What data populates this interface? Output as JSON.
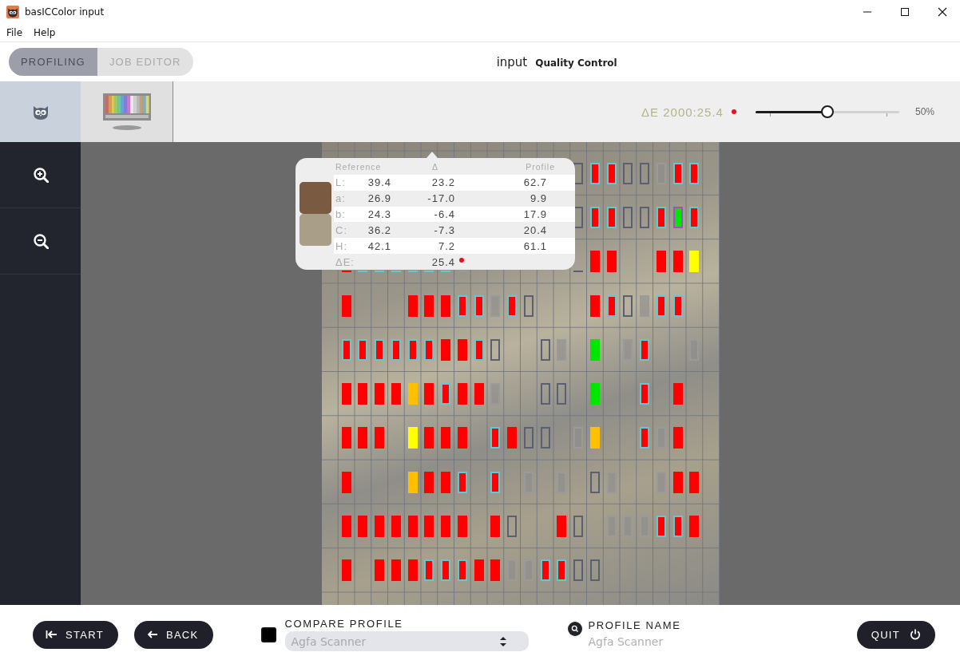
{
  "window": {
    "title": "basICColor input"
  },
  "menu": [
    "File",
    "Help"
  ],
  "mode_tabs": [
    {
      "label": "PROFILING",
      "selected": true
    },
    {
      "label": "JOB EDITOR",
      "selected": false
    }
  ],
  "header": {
    "app": "input",
    "view": "Quality Control"
  },
  "thumbnails": [
    {
      "kind": "owl",
      "selected": true
    },
    {
      "kind": "chart",
      "selected": false
    }
  ],
  "delta_e": {
    "label": "ΔE 2000:25.4",
    "tolerance_exceeded": true
  },
  "overlay_slider": {
    "level": 0.5,
    "reading": "50%"
  },
  "sidebar": {
    "tools": [
      {
        "kind": "zoom-in"
      },
      {
        "kind": "zoom-out"
      }
    ]
  },
  "patch_grid": {
    "rows": [
      {
        "patches": [
          {
            "kind": "none"
          },
          {
            "kind": "none"
          },
          {
            "kind": "none"
          },
          {
            "kind": "none"
          },
          {
            "kind": "none"
          },
          {
            "kind": "none"
          },
          {
            "kind": "none"
          },
          {
            "kind": "none"
          },
          {
            "kind": "none"
          },
          {
            "kind": "none"
          },
          {
            "kind": "none"
          },
          {
            "kind": "none"
          },
          {
            "kind": "none"
          },
          {
            "kind": "none"
          },
          {
            "kind": "hollow"
          },
          {
            "kind": "red-ring"
          },
          {
            "kind": "red-ring"
          },
          {
            "kind": "hollow"
          },
          {
            "kind": "hollow"
          },
          {
            "kind": "grey"
          },
          {
            "kind": "red-ring"
          },
          {
            "kind": "red-ring"
          }
        ]
      },
      {
        "patches": [
          {
            "kind": "none"
          },
          {
            "kind": "none"
          },
          {
            "kind": "none"
          },
          {
            "kind": "none"
          },
          {
            "kind": "none"
          },
          {
            "kind": "none"
          },
          {
            "kind": "none"
          },
          {
            "kind": "none"
          },
          {
            "kind": "none"
          },
          {
            "kind": "none"
          },
          {
            "kind": "none"
          },
          {
            "kind": "none"
          },
          {
            "kind": "none"
          },
          {
            "kind": "none"
          },
          {
            "kind": "hollow"
          },
          {
            "kind": "red-ring"
          },
          {
            "kind": "red-ring"
          },
          {
            "kind": "hollow"
          },
          {
            "kind": "hollow"
          },
          {
            "kind": "red-ring"
          },
          {
            "kind": "green-ring"
          },
          {
            "kind": "red-ring"
          }
        ]
      },
      {
        "patches": [
          {
            "kind": "red"
          },
          {
            "kind": "red-ring"
          },
          {
            "kind": "red-ring"
          },
          {
            "kind": "red-ring"
          },
          {
            "kind": "red-ring"
          },
          {
            "kind": "red-ring"
          },
          {
            "kind": "red-ring"
          },
          {
            "kind": "grey"
          },
          {
            "kind": "none"
          },
          {
            "kind": "none"
          },
          {
            "kind": "none"
          },
          {
            "kind": "none"
          },
          {
            "kind": "none"
          },
          {
            "kind": "none"
          },
          {
            "kind": "hollow"
          },
          {
            "kind": "red"
          },
          {
            "kind": "red"
          },
          {
            "kind": "none"
          },
          {
            "kind": "none"
          },
          {
            "kind": "red"
          },
          {
            "kind": "red"
          },
          {
            "kind": "yellow"
          }
        ]
      },
      {
        "patches": [
          {
            "kind": "red"
          },
          {
            "kind": "none"
          },
          {
            "kind": "none"
          },
          {
            "kind": "none"
          },
          {
            "kind": "red"
          },
          {
            "kind": "red"
          },
          {
            "kind": "red"
          },
          {
            "kind": "red-ring"
          },
          {
            "kind": "red-ring"
          },
          {
            "kind": "grey"
          },
          {
            "kind": "red-ring"
          },
          {
            "kind": "hollow"
          },
          {
            "kind": "none"
          },
          {
            "kind": "none"
          },
          {
            "kind": "none"
          },
          {
            "kind": "red"
          },
          {
            "kind": "red-ring"
          },
          {
            "kind": "hollow"
          },
          {
            "kind": "grey"
          },
          {
            "kind": "red-ring"
          },
          {
            "kind": "red-ring"
          },
          {
            "kind": "none"
          }
        ]
      },
      {
        "patches": [
          {
            "kind": "red-ring"
          },
          {
            "kind": "red-ring"
          },
          {
            "kind": "red-ring"
          },
          {
            "kind": "red-ring"
          },
          {
            "kind": "red-ring"
          },
          {
            "kind": "red-ring"
          },
          {
            "kind": "red"
          },
          {
            "kind": "red"
          },
          {
            "kind": "red-ring"
          },
          {
            "kind": "hollow"
          },
          {
            "kind": "none"
          },
          {
            "kind": "none"
          },
          {
            "kind": "hollow"
          },
          {
            "kind": "grey"
          },
          {
            "kind": "none"
          },
          {
            "kind": "green"
          },
          {
            "kind": "none"
          },
          {
            "kind": "grey"
          },
          {
            "kind": "red-ring"
          },
          {
            "kind": "none"
          },
          {
            "kind": "none"
          },
          {
            "kind": "grey"
          }
        ]
      },
      {
        "patches": [
          {
            "kind": "red"
          },
          {
            "kind": "red"
          },
          {
            "kind": "red"
          },
          {
            "kind": "red"
          },
          {
            "kind": "orange"
          },
          {
            "kind": "red"
          },
          {
            "kind": "red-ring"
          },
          {
            "kind": "red"
          },
          {
            "kind": "red"
          },
          {
            "kind": "grey"
          },
          {
            "kind": "none"
          },
          {
            "kind": "none"
          },
          {
            "kind": "hollow"
          },
          {
            "kind": "hollow"
          },
          {
            "kind": "none"
          },
          {
            "kind": "green"
          },
          {
            "kind": "none"
          },
          {
            "kind": "none"
          },
          {
            "kind": "red-ring"
          },
          {
            "kind": "none"
          },
          {
            "kind": "red"
          },
          {
            "kind": "none"
          }
        ]
      },
      {
        "patches": [
          {
            "kind": "red"
          },
          {
            "kind": "red"
          },
          {
            "kind": "red"
          },
          {
            "kind": "none"
          },
          {
            "kind": "yellow"
          },
          {
            "kind": "red"
          },
          {
            "kind": "red"
          },
          {
            "kind": "red"
          },
          {
            "kind": "none"
          },
          {
            "kind": "red-ring"
          },
          {
            "kind": "red"
          },
          {
            "kind": "hollow"
          },
          {
            "kind": "hollow"
          },
          {
            "kind": "none"
          },
          {
            "kind": "grey"
          },
          {
            "kind": "orange"
          },
          {
            "kind": "none"
          },
          {
            "kind": "none"
          },
          {
            "kind": "red-ring"
          },
          {
            "kind": "grey"
          },
          {
            "kind": "red"
          },
          {
            "kind": "none"
          }
        ]
      },
      {
        "patches": [
          {
            "kind": "red"
          },
          {
            "kind": "none"
          },
          {
            "kind": "none"
          },
          {
            "kind": "none"
          },
          {
            "kind": "orange"
          },
          {
            "kind": "red"
          },
          {
            "kind": "red"
          },
          {
            "kind": "red-ring"
          },
          {
            "kind": "none"
          },
          {
            "kind": "red-ring"
          },
          {
            "kind": "none"
          },
          {
            "kind": "grey"
          },
          {
            "kind": "none"
          },
          {
            "kind": "grey"
          },
          {
            "kind": "none"
          },
          {
            "kind": "hollow"
          },
          {
            "kind": "grey"
          },
          {
            "kind": "none"
          },
          {
            "kind": "none"
          },
          {
            "kind": "grey"
          },
          {
            "kind": "red"
          },
          {
            "kind": "red"
          }
        ]
      },
      {
        "patches": [
          {
            "kind": "red"
          },
          {
            "kind": "red"
          },
          {
            "kind": "red"
          },
          {
            "kind": "red"
          },
          {
            "kind": "red"
          },
          {
            "kind": "red"
          },
          {
            "kind": "red"
          },
          {
            "kind": "red"
          },
          {
            "kind": "none"
          },
          {
            "kind": "red"
          },
          {
            "kind": "hollow"
          },
          {
            "kind": "none"
          },
          {
            "kind": "none"
          },
          {
            "kind": "red"
          },
          {
            "kind": "hollow"
          },
          {
            "kind": "none"
          },
          {
            "kind": "grey"
          },
          {
            "kind": "grey"
          },
          {
            "kind": "grey"
          },
          {
            "kind": "red-ring"
          },
          {
            "kind": "red-ring"
          },
          {
            "kind": "red"
          }
        ]
      },
      {
        "patches": [
          {
            "kind": "red"
          },
          {
            "kind": "none"
          },
          {
            "kind": "red"
          },
          {
            "kind": "red"
          },
          {
            "kind": "red"
          },
          {
            "kind": "red-ring"
          },
          {
            "kind": "red-ring"
          },
          {
            "kind": "red-ring"
          },
          {
            "kind": "red"
          },
          {
            "kind": "red"
          },
          {
            "kind": "grey"
          },
          {
            "kind": "grey"
          },
          {
            "kind": "red-ring"
          },
          {
            "kind": "red-ring"
          },
          {
            "kind": "hollow"
          },
          {
            "kind": "hollow"
          },
          {
            "kind": "none"
          },
          {
            "kind": "none"
          },
          {
            "kind": "none"
          },
          {
            "kind": "none"
          },
          {
            "kind": "none"
          },
          {
            "kind": "none"
          }
        ]
      }
    ]
  },
  "tooltip": {
    "columns": [
      "Reference",
      "Δ",
      "Profile"
    ],
    "swatches": [
      {
        "color": "#7a5a40"
      },
      {
        "color": "#a99e88"
      }
    ],
    "rows": [
      {
        "label": "L:",
        "reference": "39.4",
        "delta": "23.2",
        "profile": "62.7"
      },
      {
        "label": "a:",
        "reference": "26.9",
        "delta": "-17.0",
        "profile": "9.9"
      },
      {
        "label": "b:",
        "reference": "24.3",
        "delta": "-6.4",
        "profile": "17.9"
      },
      {
        "label": "C:",
        "reference": "36.2",
        "delta": "-7.3",
        "profile": "20.4"
      },
      {
        "label": "H:",
        "reference": "42.1",
        "delta": "7.2",
        "profile": "61.1"
      }
    ],
    "delta_e": {
      "label": "ΔE:",
      "value": "25.4",
      "tolerance_exceeded": true
    }
  },
  "footer": {
    "buttons": [
      {
        "kind": "start",
        "label": "START"
      },
      {
        "kind": "back",
        "label": "BACK"
      }
    ],
    "compare": {
      "checked": true,
      "label": "COMPARE PROFILE",
      "value": "Agfa Scanner"
    },
    "profile_name": {
      "label": "PROFILE NAME",
      "placeholder": "Agfa Scanner"
    },
    "quit": {
      "label": "QUIT"
    }
  }
}
